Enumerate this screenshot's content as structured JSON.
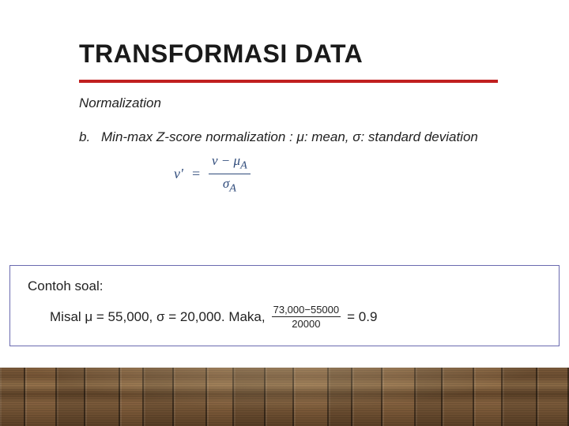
{
  "slide": {
    "title": "TRANSFORMASI DATA",
    "subtitle": "Normalization",
    "bullet": {
      "label": "b.",
      "text": "Min-max Z-score normalization : μ: mean, σ: standard deviation"
    },
    "formula": {
      "lhs": "v'",
      "eq": "=",
      "numerator": "v − μ",
      "num_sub": "A",
      "denominator": "σ",
      "den_sub": "A"
    },
    "example": {
      "title": "Contoh soal:",
      "prefix": "Misal μ = 55,000, σ = 20,000. Maka,",
      "frac_num": "73,000−55000",
      "frac_den": "20000",
      "tail": "= 0.9"
    }
  },
  "floor": {
    "plank_widths": [
      32,
      40,
      36,
      44,
      30,
      38,
      42,
      34,
      40,
      36,
      44,
      30,
      38,
      42,
      34,
      40,
      36,
      44,
      40
    ]
  }
}
